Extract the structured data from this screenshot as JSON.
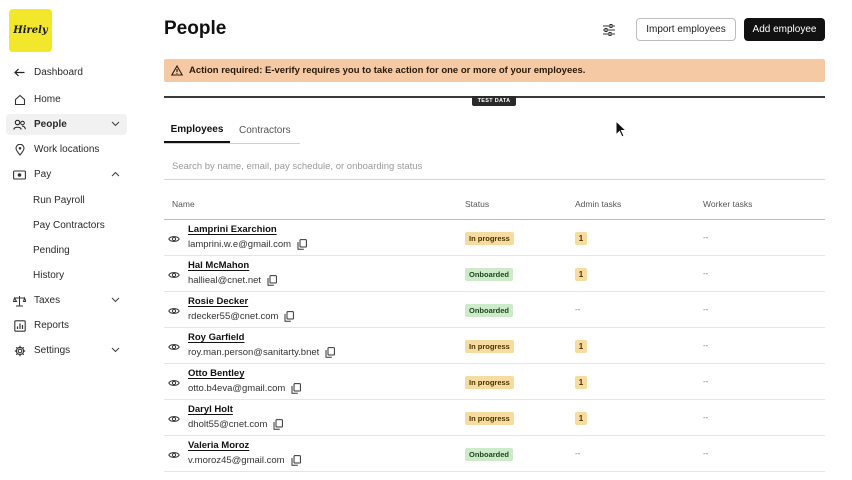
{
  "brand": {
    "logo_text": "Hirely",
    "logo_color": "#f2e72a"
  },
  "sidebar": {
    "back_label": "Dashboard",
    "items": [
      {
        "label": "Home"
      },
      {
        "label": "People"
      },
      {
        "label": "Work locations"
      },
      {
        "label": "Pay"
      },
      {
        "label": "Taxes"
      },
      {
        "label": "Reports"
      },
      {
        "label": "Settings"
      }
    ],
    "pay_sub": [
      {
        "label": "Run Payroll"
      },
      {
        "label": "Pay Contractors"
      },
      {
        "label": "Pending"
      },
      {
        "label": "History"
      }
    ]
  },
  "header": {
    "title": "People",
    "import_label": "Import employees",
    "add_label": "Add employee"
  },
  "alert": {
    "text": "Action required: E-verify requires you to take action for one or more of your employees.",
    "color": "#f5c9a3"
  },
  "test_badge": "TEST DATA",
  "tabs": [
    {
      "label": "Employees"
    },
    {
      "label": "Contractors"
    }
  ],
  "search": {
    "placeholder": "Search by name, email, pay schedule, or onboarding status"
  },
  "table": {
    "columns": [
      "Name",
      "Status",
      "Admin tasks",
      "Worker tasks"
    ],
    "rows": [
      {
        "name": "Lamprini Exarchion",
        "email": "lamprini.w.e@gmail.com",
        "status": "In progress",
        "admin": "1",
        "worker": "--"
      },
      {
        "name": "Hal McMahon",
        "email": "hallieal@cnet.net",
        "status": "Onboarded",
        "admin": "1",
        "worker": "--"
      },
      {
        "name": "Rosie Decker",
        "email": "rdecker55@cnet.com",
        "status": "Onboarded",
        "admin": "--",
        "worker": "--"
      },
      {
        "name": "Roy Garfield",
        "email": "roy.man.person@sanitarty.bnet",
        "status": "In progress",
        "admin": "1",
        "worker": "--"
      },
      {
        "name": "Otto Bentley",
        "email": "otto.b4eva@gmail.com",
        "status": "In progress",
        "admin": "1",
        "worker": "--"
      },
      {
        "name": "Daryl Holt",
        "email": "dholt55@cnet.com",
        "status": "In progress",
        "admin": "1",
        "worker": "--"
      },
      {
        "name": "Valeria Moroz",
        "email": "v.moroz45@gmail.com",
        "status": "Onboarded",
        "admin": "--",
        "worker": "--"
      }
    ]
  },
  "colors": {
    "in_progress_bg": "#f6dca0",
    "onboarded_bg": "#cdeac9",
    "primary_button": "#111111"
  }
}
